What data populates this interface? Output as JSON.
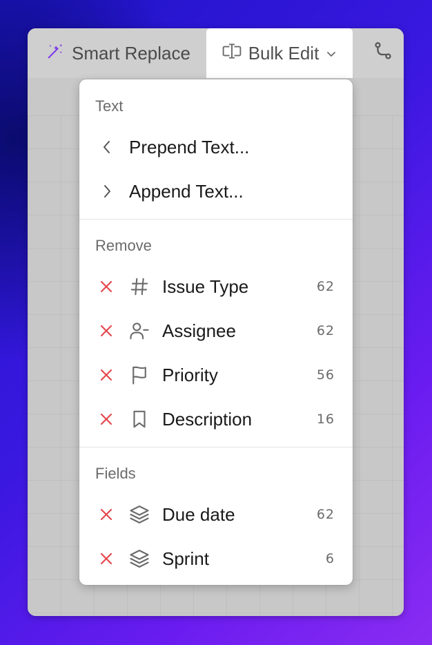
{
  "toolbar": {
    "smart_replace_label": "Smart Replace",
    "bulk_edit_label": "Bulk Edit"
  },
  "menu": {
    "text_section": {
      "title": "Text",
      "items": [
        {
          "label": "Prepend Text...",
          "icon": "chevron-left-icon"
        },
        {
          "label": "Append Text...",
          "icon": "chevron-right-icon"
        }
      ]
    },
    "remove_section": {
      "title": "Remove",
      "items": [
        {
          "label": "Issue Type",
          "icon": "hash-icon",
          "count": "62"
        },
        {
          "label": "Assignee",
          "icon": "user-minus-icon",
          "count": "62"
        },
        {
          "label": "Priority",
          "icon": "flag-icon",
          "count": "56"
        },
        {
          "label": "Description",
          "icon": "bookmark-icon",
          "count": "16"
        }
      ]
    },
    "fields_section": {
      "title": "Fields",
      "items": [
        {
          "label": "Due date",
          "icon": "layers-icon",
          "count": "62"
        },
        {
          "label": "Sprint",
          "icon": "layers-icon",
          "count": "6"
        }
      ]
    }
  },
  "colors": {
    "remove_x": "#e5484d",
    "smart_replace_icon": "#7c3aed"
  }
}
